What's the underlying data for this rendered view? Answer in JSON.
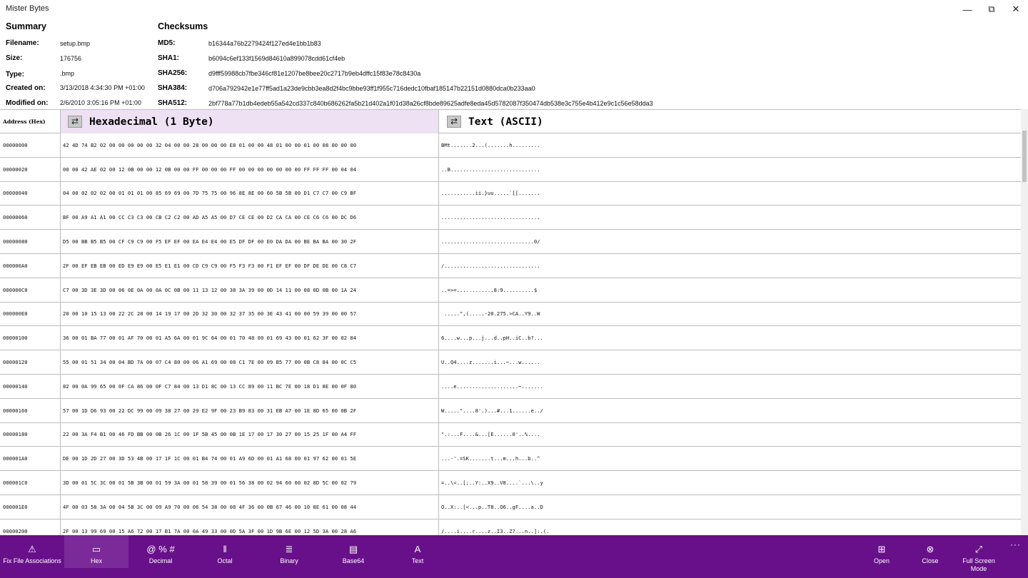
{
  "window": {
    "title": "Mister Bytes",
    "controls": [
      "—",
      "⧉",
      "✕"
    ]
  },
  "summary": {
    "heading": "Summary",
    "rows": [
      {
        "label": "Filename:",
        "value": "setup.bmp"
      },
      {
        "label": "Size:",
        "value": "176756"
      },
      {
        "label": "Type:",
        "value": ".bmp"
      },
      {
        "label": "Created on:",
        "value": "3/13/2018 4:34:30 PM +01:00"
      },
      {
        "label": "Modified on:",
        "value": "2/6/2010 3:05:16 PM +01:00"
      }
    ]
  },
  "checksums": {
    "heading": "Checksums",
    "rows": [
      {
        "label": "MD5:",
        "value": "b16344a76b2279424f127ed4e1bb1b83"
      },
      {
        "label": "SHA1:",
        "value": "b6094c6ef133f1569d84610a899078cdd61cf4eb"
      },
      {
        "label": "SHA256:",
        "value": "d9fff59988cb7fbe346cf81e1207be8bee20c2717b9eb4dffc15f83e78c8430a"
      },
      {
        "label": "SHA384:",
        "value": "d706a792942e1e77ff5ad1a23de9cbb3ea8d2f4bc9bbe93ff1f955c716dedc10fbaf185147b22151d0880dca0b233aa0"
      },
      {
        "label": "SHA512:",
        "value": "2bf778a77b1db4edeb55a542cd337c840b686262fa5b21d402a1f01d38a26cf8bde89625adfe8eda45d5782087f350474db538e3c755e4b412e9c1c56e58dda3"
      }
    ]
  },
  "table": {
    "headers": {
      "address": "Address (Hex)",
      "hex": "Hexadecimal (1 Byte)",
      "text": "Text (ASCII)"
    },
    "rows": [
      {
        "addr": "00000000",
        "hex": "42 4D 74 B2 02 00 00 00 00 00 32 04 00 00 28 00 00 00 E8 01 00 00 48 01 00 00 01 00 08 00 00 00",
        "ascii": "BMt.......2...(.......h........."
      },
      {
        "addr": "00000020",
        "hex": "00 00 42 AE 02 00 12 0B 00 00 12 0B 00 00 FF 00 00 00 FF 00 00 00 00 00 00 00 FF FF FF 00 04 04",
        "ascii": "..B............................."
      },
      {
        "addr": "00000040",
        "hex": "04 00 02 02 02 00 01 01 01 00 85 69 69 00 7D 75 75 00 96 8E 8E 00 60 5B 5B 00 D1 C7 C7 00 C9 BF",
        "ascii": "...........ii.}uu.....`[[......."
      },
      {
        "addr": "00000060",
        "hex": "BF 00 A9 A1 A1 00 CC C3 C3 00 CB C2 C2 00 AD A5 A5 00 D7 CE CE 00 D2 CA CA 00 CE C6 C6 00 DC D6",
        "ascii": "................................"
      },
      {
        "addr": "00000080",
        "hex": "D5 00 BB B5 B5 00 CF C9 C9 00 F5 EF EF 00 EA E4 E4 00 E5 DF DF 00 E0 DA DA 00 BE BA BA 00 30 2F",
        "ascii": "..............................0/"
      },
      {
        "addr": "000000A0",
        "hex": "2F 00 EF EB EB 00 ED E9 E9 00 E5 E1 E1 00 CD C9 C9 00 F5 F3 F3 00 F1 EF EF 00 DF DE DE 00 C8 C7",
        "ascii": "/..............................."
      },
      {
        "addr": "000000C0",
        "hex": "C7 00 3D 3E 3D 00 06 0E 0A 00 0A 0C 0B 00 11 13 12 00 38 3A 39 00 0D 14 11 00 08 0D 0B 00 1A 24",
        "ascii": "..=>=............8:9..........$"
      },
      {
        "addr": "000000E0",
        "hex": "20 00 10 15 13 00 22 2C 28 00 14 19 17 00 2D 32 30 00 32 37 35 00 3E 43 41 00 00 59 39 00 00 57",
        "ascii": " .....\",(.....-20.275.>CA..Y9..W"
      },
      {
        "addr": "00000100",
        "hex": "36 00 01 BA 77 00 01 AF 70 00 01 A5 6A 00 01 9C 64 00 01 70 48 00 01 69 43 00 01 62 3F 00 02 84",
        "ascii": "6....w...p...j...d..pH..iC..b?..."
      },
      {
        "addr": "00000120",
        "hex": "55 00 01 51 34 00 04 BD 7A 00 07 C4 80 00 06 A1 69 00 08 C1 7E 00 09 B5 77 00 0B C8 84 00 0C C5",
        "ascii": "U..Q4....z.......i...~...w......"
      },
      {
        "addr": "00000140",
        "hex": "82 00 0A 99 65 00 0F CA 86 00 0F C7 84 00 13 D1 8C 00 13 CC 89 00 11 BC 7E 00 18 D1 8E 00 0F 80",
        "ascii": "....e....................~......."
      },
      {
        "addr": "00000160",
        "hex": "57 00 1D D6 93 00 22 DC 99 00 09 38 27 00 29 E2 9F 00 23 B9 83 00 31 EB A7 00 1E 8D 65 00 0B 2F",
        "ascii": "W.....\"....8'.)...#...1......e../"
      },
      {
        "addr": "00000180",
        "hex": "22 00 3A F4 B1 00 46 FD BB 00 0B 26 1C 00 1F 5B 45 00 0B 1E 17 00 17 30 27 00 15 25 1F 00 A4 FF",
        "ascii": "\".:...F....&...[E......0'..%...."
      },
      {
        "addr": "000001A0",
        "hex": "DE 00 1D 2D 27 00 3D 53 4B 00 17 1F 1C 00 01 B4 74 00 01 A9 6D 00 01 A1 68 00 01 97 62 00 01 5E",
        "ascii": "...-'.=SK.......t...m...h...b..^"
      },
      {
        "addr": "000001C0",
        "hex": "3D 00 01 5C 3C 00 01 5B 3B 00 01 59 3A 00 01 58 39 00 01 56 38 00 02 94 60 00 02 8D 5C 00 02 79",
        "ascii": "=..\\<..[;..Y:..X9..V8....`...\\..y"
      },
      {
        "addr": "000001E0",
        "hex": "4F 00 03 58 3A 00 04 5B 3C 00 09 A9 70 00 06 54 38 00 08 4F 36 00 0B 67 46 00 10 8E 61 00 08 44",
        "ascii": "O..X:..[<...p..T8..O6..gF....a..D"
      },
      {
        "addr": "00000200",
        "hex": "2F 00 13 99 69 00 15 A6 72 00 17 B1 7A 00 0A 49 33 00 0D 5A 3F 00 1D 9B 6E 00 12 5D 3A 00 28 A6",
        "ascii": "/....i....r....z..I3..Z?...n..]:.(."
      }
    ]
  },
  "commands": [
    {
      "label": "Fix File Associations",
      "icon": "warning-icon",
      "glyph": "⚠"
    },
    {
      "label": "Hex",
      "icon": "hex-icon",
      "glyph": "▭",
      "active": true
    },
    {
      "label": "Decimal",
      "icon": "decimal-icon",
      "glyph": "@ % #"
    },
    {
      "label": "Octal",
      "icon": "octal-icon",
      "glyph": "‖"
    },
    {
      "label": "Binary",
      "icon": "binary-icon",
      "glyph": "≣"
    },
    {
      "label": "Base64",
      "icon": "base64-icon",
      "glyph": "▤"
    },
    {
      "label": "Text",
      "icon": "text-icon",
      "glyph": "A"
    },
    {
      "label": "Open",
      "icon": "open-icon",
      "glyph": "⊞"
    },
    {
      "label": "Close",
      "icon": "close-circle-icon",
      "glyph": "⊗"
    },
    {
      "label": "Full Screen Mode",
      "icon": "fullscreen-icon",
      "glyph": "⤢"
    }
  ],
  "more_glyph": "···",
  "colors": {
    "command_bar": "#68108a",
    "hex_header": "#ede1f3",
    "warning": "#e2253c"
  }
}
